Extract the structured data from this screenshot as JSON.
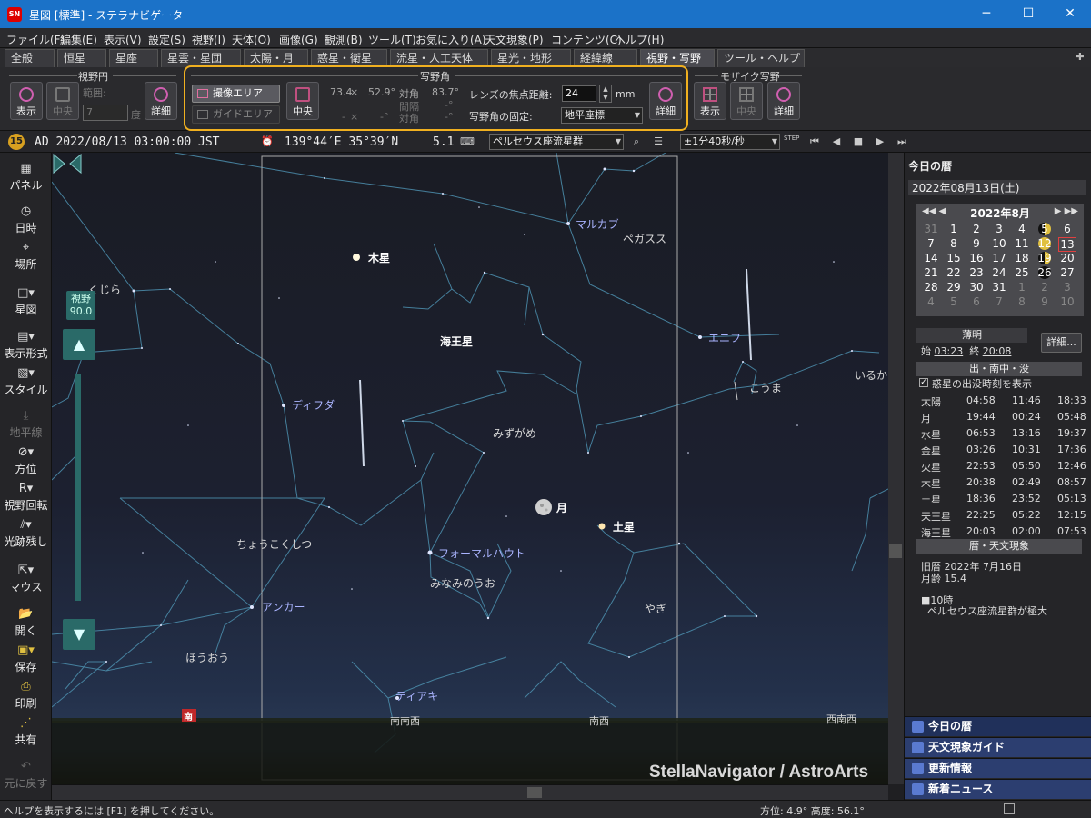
{
  "window": {
    "title": "星図 [標準] - ステラナビゲータ",
    "min": "─",
    "max": "☐",
    "close": "✕",
    "app_icon": "SN"
  },
  "menu": [
    "ファイル(F)",
    "編集(E)",
    "表示(V)",
    "設定(S)",
    "視野(I)",
    "天体(O)",
    "画像(G)",
    "観測(B)",
    "ツール(T)",
    "お気に入り(A)",
    "天文現象(P)",
    "コンテンツ(C)",
    "ヘルプ(H)"
  ],
  "tabs": [
    "全般",
    "恒星",
    "星座",
    "星雲・星団",
    "太陽・月",
    "惑星・衛星",
    "流星・人工天体",
    "星光・地形",
    "経緯線",
    "視野・写野",
    "ツール・ヘルプ"
  ],
  "toolpanel": {
    "fov_circle": {
      "title": "視野円",
      "show": "表示",
      "center": "中央",
      "range_label": "範囲:",
      "range_value": "7",
      "unit": "度",
      "detail": "詳細"
    },
    "photo": {
      "title": "写野角",
      "capture_area": "撮像エリア",
      "guide_area": "ガイドエリア",
      "center": "中央",
      "w": "73.4",
      "x1": "×",
      "h": "52.9°",
      "diag_label": "対角",
      "diag": "83.7°",
      "gap_label": "間隔",
      "gap": "-°",
      "diag2_label": "対角",
      "diag2": "-°",
      "w2": "-",
      "x2": "×",
      "h2": "-°",
      "focal_label": "レンズの焦点距離:",
      "focal_value": "24",
      "focal_unit": "mm",
      "fix_label": "写野角の固定:",
      "fix_value": "地平座標",
      "detail": "詳細"
    },
    "mosaic": {
      "title": "モザイク写野",
      "show": "表示",
      "center": "中央",
      "detail": "詳細"
    }
  },
  "status": {
    "badge": "15",
    "datetime": "AD 2022/08/13 03:00:00 JST",
    "coords": "139°44′E 35°39′N",
    "mag": "5.1",
    "object": "ペルセウス座流星群",
    "speed": "±1分40秒/秒",
    "step": "STEP"
  },
  "leftbar": [
    "パネル",
    "日時",
    "場所",
    "星図",
    "表示形式",
    "スタイル",
    "地平線",
    "方位",
    "視野回転",
    "光跡残し",
    "マウス",
    "開く",
    "保存",
    "印刷",
    "共有",
    "元に戻す"
  ],
  "leftbar_icons": [
    "panel-icon",
    "clock-icon",
    "location-icon",
    "chart-icon",
    "format-icon",
    "style-icon",
    "horizon-icon",
    "compass-icon",
    "rotate-icon",
    "trail-icon",
    "mouse-icon",
    "open-icon",
    "save-icon",
    "print-icon",
    "share-icon",
    "undo-icon"
  ],
  "fov": {
    "label": "視野",
    "value": "90.0"
  },
  "sky_labels": {
    "jupiter": "木星",
    "neptune": "海王星",
    "moon": "月",
    "saturn": "土星",
    "markab": "マルカブ",
    "pegasus": "ペガスス",
    "enif": "エニフ",
    "equuleus": "こうま",
    "delphinus": "いるか",
    "cetus": "くじら",
    "diphda": "ディフダ",
    "aquarius": "みずがめ",
    "sculptor": "ちょうこくしつ",
    "fomalhaut": "フォーマルハウト",
    "psa": "みなみのうお",
    "capricornus": "やぎ",
    "ankaa": "アンカー",
    "phoenix": "ほうおう",
    "tucana": "ティアキ",
    "south_sw": "南南西",
    "sw": "南西",
    "wsw": "西南西",
    "south": "南"
  },
  "watermark": "StellaNavigator / AstroArts",
  "right": {
    "title": "今日の暦",
    "date": "2022年08月13日(土)",
    "cal_title": "2022年8月",
    "cal_prev": "◀◀ ◀",
    "cal_next": "▶ ▶▶",
    "cal_days": [
      "31",
      "1",
      "2",
      "3",
      "4",
      "5",
      "6",
      "7",
      "8",
      "9",
      "10",
      "11",
      "12",
      "13",
      "14",
      "15",
      "16",
      "17",
      "18",
      "19",
      "20",
      "21",
      "22",
      "23",
      "24",
      "25",
      "26",
      "27",
      "28",
      "29",
      "30",
      "31",
      "1",
      "2",
      "3",
      "4",
      "5",
      "6",
      "7",
      "8",
      "9",
      "10"
    ],
    "twilight": "薄明",
    "tw_start_label": "始",
    "tw_start": "03:23",
    "tw_end_label": "終",
    "tw_end": "20:08",
    "detail": "詳細...",
    "rise_title": "出・南中・没",
    "rise_check": "惑星の出没時刻を表示",
    "rise_rows": [
      [
        "太陽",
        "04:58",
        "11:46",
        "18:33"
      ],
      [
        "月",
        "19:44",
        "00:24",
        "05:48"
      ],
      [
        "水星",
        "06:53",
        "13:16",
        "19:37"
      ],
      [
        "金星",
        "03:26",
        "10:31",
        "17:36"
      ],
      [
        "火星",
        "22:53",
        "05:50",
        "12:46"
      ],
      [
        "木星",
        "20:38",
        "02:49",
        "08:57"
      ],
      [
        "土星",
        "18:36",
        "23:52",
        "05:13"
      ],
      [
        "天王星",
        "22:25",
        "05:22",
        "12:15"
      ],
      [
        "海王星",
        "20:03",
        "02:00",
        "07:53"
      ]
    ],
    "phen_title": "暦・天文現象",
    "lunar": "旧暦  2022年 7月16日",
    "age": "月齢  15.4",
    "event_time": "■10時",
    "event": "ペルセウス座流星群が極大",
    "nav": [
      "今日の暦",
      "天文現象ガイド",
      "更新情報",
      "新着ニュース"
    ]
  },
  "statusbar": {
    "help": "ヘルプを表示するには [F1] を押してください。",
    "coords": "方位:  4.9°   高度:  56.1°"
  }
}
